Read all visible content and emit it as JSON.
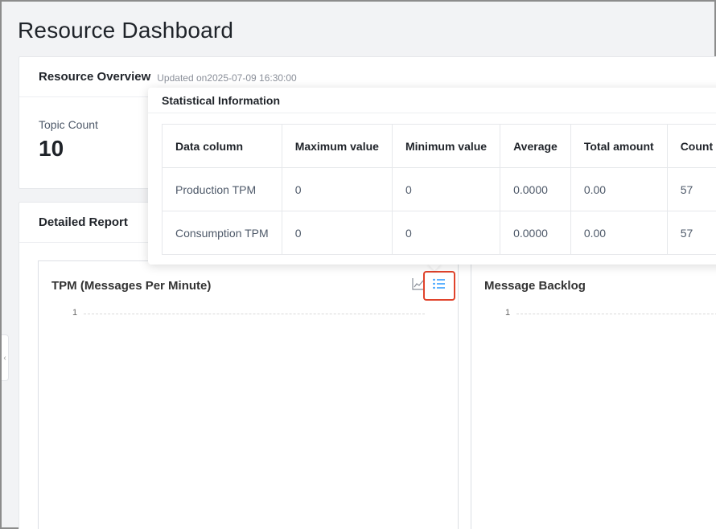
{
  "page": {
    "title": "Resource Dashboard"
  },
  "overview": {
    "title": "Resource Overview",
    "updated": "Updated on2025-07-09 16:30:00",
    "topic_count_label": "Topic Count",
    "topic_count_value": "10"
  },
  "report": {
    "title": "Detailed Report"
  },
  "charts": {
    "tpm": {
      "title": "TPM (Messages Per Minute)",
      "y_tick": "1"
    },
    "backlog": {
      "title": "Message Backlog",
      "y_tick": "1"
    }
  },
  "toolbar": {
    "line_icon": "line-chart-icon",
    "list_icon": "list-icon",
    "accent": "#1890ff",
    "highlight": "#e0432b"
  },
  "popover": {
    "title": "Statistical Information",
    "columns": [
      "Data column",
      "Maximum value",
      "Minimum value",
      "Average",
      "Total amount",
      "Count"
    ],
    "rows": [
      [
        "Production TPM",
        "0",
        "0",
        "0.0000",
        "0.00",
        "57"
      ],
      [
        "Consumption TPM",
        "0",
        "0",
        "0.0000",
        "0.00",
        "57"
      ]
    ]
  },
  "side_handle": {
    "icon": "chevron-left-icon"
  }
}
